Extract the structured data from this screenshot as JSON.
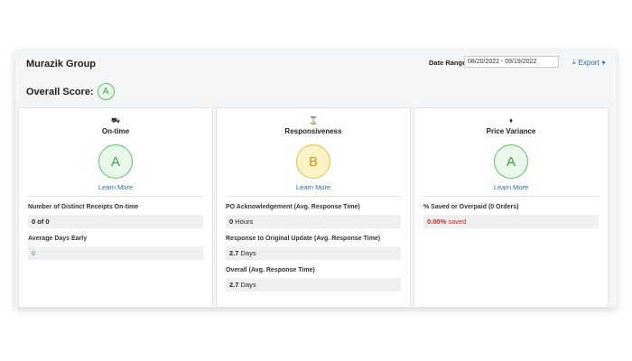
{
  "header": {
    "company": "Murazik Group",
    "date_range_label": "Date Range",
    "date_range_value": "08/20/2022 - 09/19/2022",
    "export_label": "Export",
    "export_icon": "download-icon"
  },
  "overall": {
    "label": "Overall Score:",
    "grade": "A"
  },
  "cards": [
    {
      "icon": "truck-icon",
      "title": "On-time",
      "grade": "A",
      "grade_color": "#3d9d48",
      "learn_more": "Learn More",
      "metrics": [
        {
          "label": "Number of Distinct Receipts On-time",
          "value": "0 of 0"
        },
        {
          "label": "Average Days Early",
          "value": "0"
        }
      ]
    },
    {
      "icon": "hourglass-icon",
      "title": "Responsiveness",
      "grade": "B",
      "grade_color": "#c39d17",
      "learn_more": "Learn More",
      "metrics": [
        {
          "label": "PO Acknowledgement (Avg. Response Time)",
          "value_num": "0",
          "value_unit": "Hours"
        },
        {
          "label": "Response to Original Update (Avg. Response Time)",
          "value_num": "2.7",
          "value_unit": "Days"
        },
        {
          "label": "Overall (Avg. Response Time)",
          "value_num": "2.7",
          "value_unit": "Days"
        }
      ]
    },
    {
      "icon": "tag-icon",
      "title": "Price Variance",
      "grade": "A",
      "grade_color": "#3d9d48",
      "learn_more": "Learn More",
      "metrics": [
        {
          "label": "% Saved or Overpaid (0 Orders)",
          "value_num": "0.00%",
          "value_unit": "saved"
        }
      ]
    }
  ]
}
